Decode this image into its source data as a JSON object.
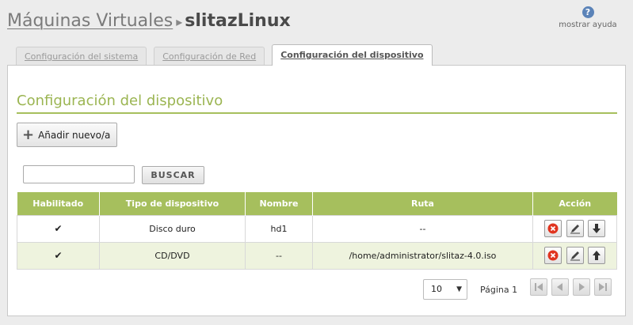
{
  "header": {
    "breadcrumb_parent": "Máquinas Virtuales",
    "breadcrumb_separator": "▸",
    "breadcrumb_current": "slitazLinux",
    "help_label": "mostrar ayuda"
  },
  "tabs": [
    {
      "label": "Configuración del sistema",
      "active": false
    },
    {
      "label": "Configuración de Red",
      "active": false
    },
    {
      "label": "Configuración del dispositivo",
      "active": true
    }
  ],
  "section": {
    "title": "Configuración del dispositivo",
    "add_button": "Añadir nuevo/a"
  },
  "search": {
    "value": "",
    "button": "BUSCAR"
  },
  "table": {
    "columns": [
      "Habilitado",
      "Tipo de dispositivo",
      "Nombre",
      "Ruta",
      "Acción"
    ],
    "rows": [
      {
        "enabled": "✔",
        "type": "Disco duro",
        "name": "hd1",
        "path": "--"
      },
      {
        "enabled": "✔",
        "type": "CD/DVD",
        "name": "--",
        "path": "/home/administrator/slitaz-4.0.iso"
      }
    ]
  },
  "pagination": {
    "page_size": "10",
    "page_label": "Página 1"
  },
  "colors": {
    "accent": "#a6bf5d",
    "title_green": "#9bb552",
    "delete_red": "#e0341f",
    "help_blue": "#5b83b8"
  }
}
